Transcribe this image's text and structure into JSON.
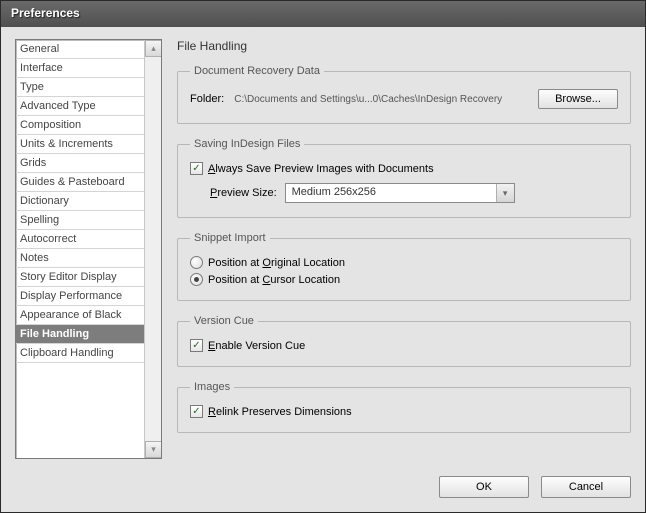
{
  "window": {
    "title": "Preferences"
  },
  "page_title": "File Handling",
  "sidebar": {
    "items": [
      {
        "label": "General"
      },
      {
        "label": "Interface"
      },
      {
        "label": "Type"
      },
      {
        "label": "Advanced Type"
      },
      {
        "label": "Composition"
      },
      {
        "label": "Units & Increments"
      },
      {
        "label": "Grids"
      },
      {
        "label": "Guides & Pasteboard"
      },
      {
        "label": "Dictionary"
      },
      {
        "label": "Spelling"
      },
      {
        "label": "Autocorrect"
      },
      {
        "label": "Notes"
      },
      {
        "label": "Story Editor Display"
      },
      {
        "label": "Display Performance"
      },
      {
        "label": "Appearance of Black"
      },
      {
        "label": "File Handling",
        "selected": true
      },
      {
        "label": "Clipboard Handling"
      }
    ]
  },
  "groups": {
    "recovery": {
      "legend": "Document Recovery Data",
      "folder_label": "Folder:",
      "folder_path": "C:\\Documents and Settings\\u...0\\Caches\\InDesign Recovery",
      "browse": "Browse..."
    },
    "saving": {
      "legend": "Saving InDesign Files",
      "always_save_prefix": "A",
      "always_save_rest": "lways Save Preview Images with Documents",
      "preview_label_prefix": "P",
      "preview_label_rest": "review Size:",
      "preview_value": "Medium 256x256"
    },
    "snippet": {
      "legend": "Snippet Import",
      "option1_prefix": "Position at ",
      "option1_ul": "O",
      "option1_rest": "riginal Location",
      "option2_prefix": "Position at ",
      "option2_ul": "C",
      "option2_rest": "ursor Location"
    },
    "version_cue": {
      "legend": "Version Cue",
      "enable_ul": "E",
      "enable_rest": "nable Version Cue"
    },
    "images": {
      "legend": "Images",
      "relink_ul": "R",
      "relink_rest": "elink Preserves Dimensions"
    }
  },
  "buttons": {
    "ok": "OK",
    "cancel": "Cancel"
  }
}
